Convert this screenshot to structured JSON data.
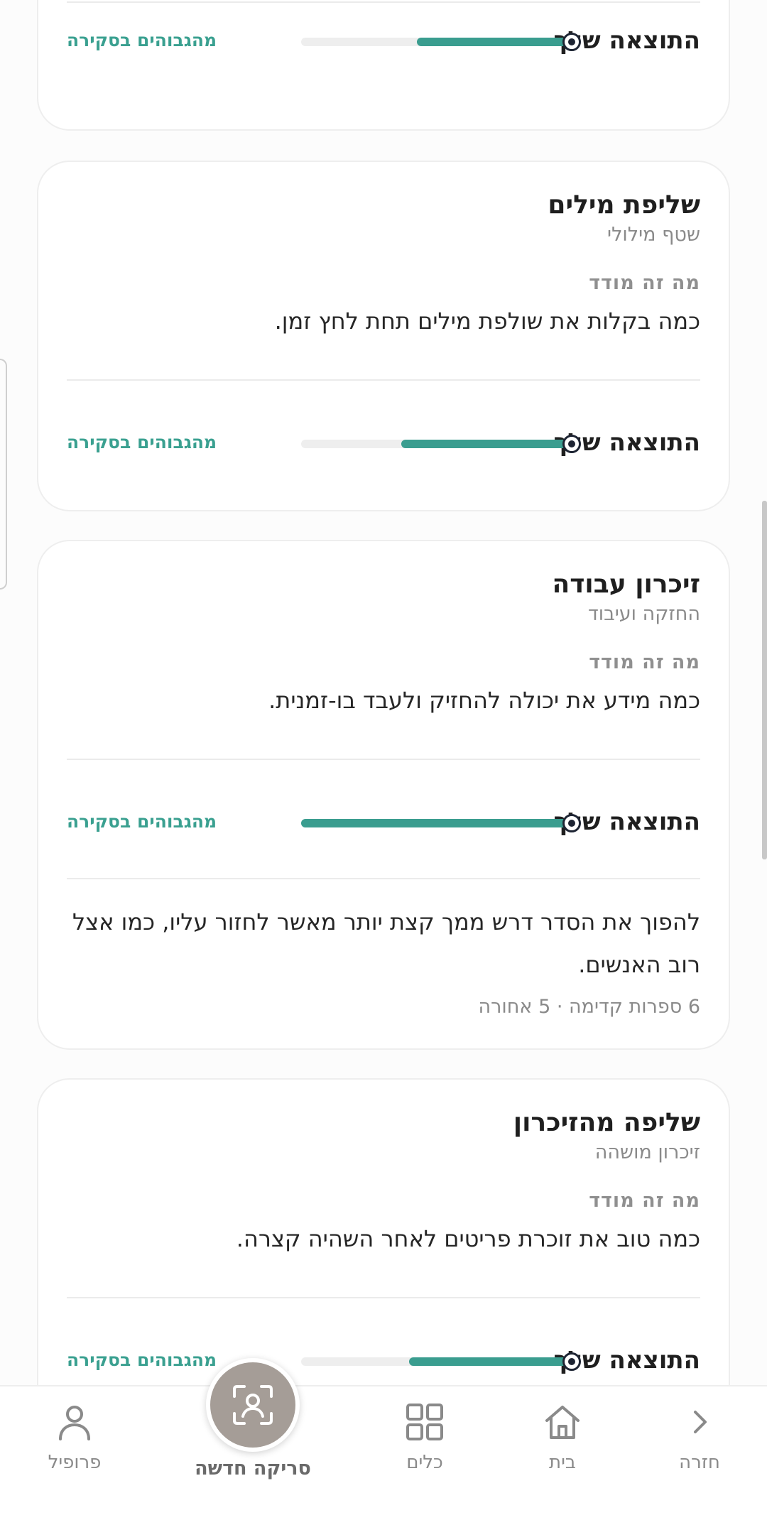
{
  "common": {
    "measure_label": "מה זה מודד",
    "result_label": "התוצאה שלך",
    "percentile_label": "מהגבוהים בסקירה"
  },
  "cards": [
    {
      "result_fraction": 0.57
    },
    {
      "title": "שליפת מילים",
      "subtitle": "שטף מילולי",
      "measure_text": "כמה בקלות את שולפת מילים תחת לחץ זמן.",
      "result_fraction": 0.63
    },
    {
      "title": "זיכרון עבודה",
      "subtitle": "החזקה ועיבוד",
      "measure_text": "כמה מידע את יכולה להחזיק ולעבד בו-זמנית.",
      "result_fraction": 1.0,
      "note_text": "להפוך את הסדר דרש ממך קצת יותר מאשר לחזור עליו, כמו אצל רוב האנשים.",
      "note_meta": "6 ספרות קדימה · 5 אחורה"
    },
    {
      "title": "שליפה מהזיכרון",
      "subtitle": "זיכרון מושהה",
      "measure_text": "כמה טוב את זוכרת פריטים לאחר השהיה קצרה.",
      "result_fraction": 0.6
    }
  ],
  "nav": {
    "back": "חזרה",
    "home": "בית",
    "tools": "כלים",
    "new_scan": "סריקה חדשה",
    "profile": "פרופיל"
  },
  "colors": {
    "accent": "#3a9d8f",
    "scan_button": "#a59d97"
  }
}
